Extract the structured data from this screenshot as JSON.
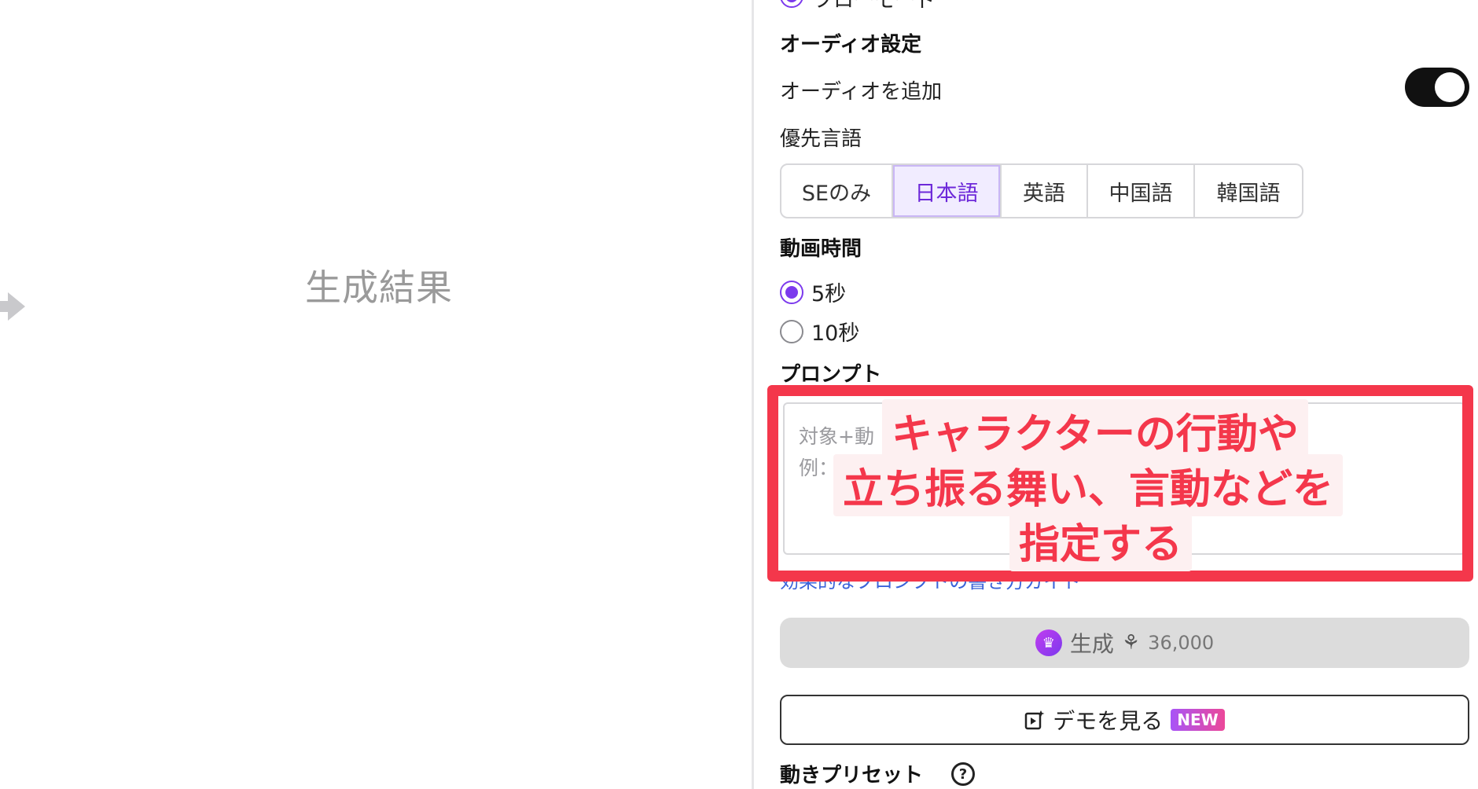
{
  "result_pane": {
    "label": "生成結果"
  },
  "settings": {
    "partial_option": "フローモード",
    "audio_section_title": "オーディオ設定",
    "add_audio_label": "オーディオを追加",
    "add_audio_enabled": true,
    "preferred_language_label": "優先言語",
    "languages": [
      {
        "label": "SEのみ",
        "active": false
      },
      {
        "label": "日本語",
        "active": true
      },
      {
        "label": "英語",
        "active": false
      },
      {
        "label": "中国語",
        "active": false
      },
      {
        "label": "韓国語",
        "active": false
      }
    ],
    "duration_title": "動画時間",
    "durations": [
      {
        "label": "5秒",
        "checked": true
      },
      {
        "label": "10秒",
        "checked": false
      }
    ],
    "prompt_title": "プロンプト",
    "prompt_placeholder_line1": "対象+動",
    "prompt_placeholder_line2": "例：",
    "guide_link": "効果的なプロンプトの書き方ガイド",
    "generate_label": "生成",
    "credit_cost": "36,000",
    "demo_label": "デモを見る",
    "new_badge": "NEW",
    "motion_preset_title": "動きプリセット"
  },
  "annotation": {
    "line1": "キャラクターの行動や",
    "line2": "立ち振る舞い、言動などを",
    "line3": "指定する"
  },
  "colors": {
    "accent": "#7c3aed",
    "annotation": "#f4374b",
    "link": "#3b63d9"
  }
}
